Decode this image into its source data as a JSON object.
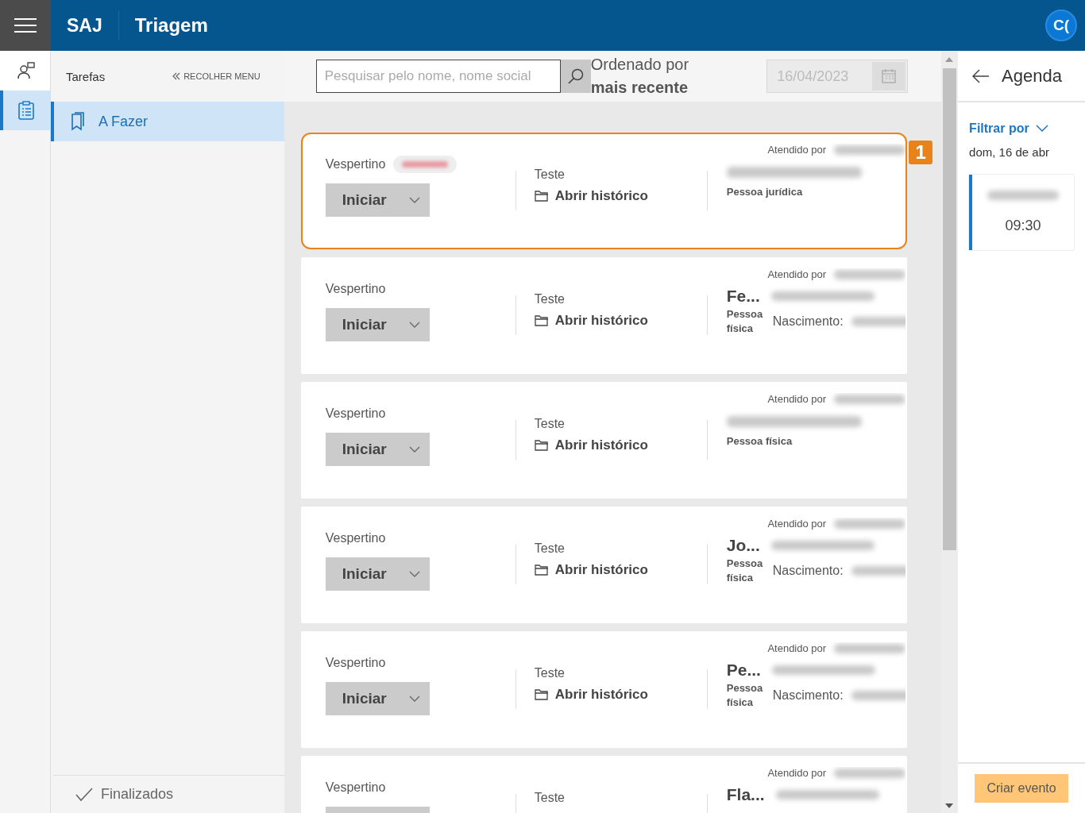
{
  "header": {
    "brand": "SAJ",
    "title": "Triagem",
    "avatar": "C("
  },
  "rail": [
    {
      "kind": "person",
      "selected": false
    },
    {
      "kind": "tasks",
      "selected": true
    }
  ],
  "sidebar": {
    "title": "Tarefas",
    "collapse": "RECOLHER MENU",
    "items": [
      {
        "label": "A Fazer",
        "selected": true
      }
    ],
    "footer": "Finalizados"
  },
  "toolbar": {
    "search_placeholder": "Pesquisar pelo nome, nome social",
    "sort_label": "Ordenado por",
    "sort_value": "mais recente",
    "date": "16/04/2023"
  },
  "cards": [
    {
      "kind": "company",
      "highlighted": true,
      "badge": "1",
      "shift": "Vespertino",
      "tag": true,
      "button": "Iniciar",
      "service": "Teste",
      "history": "Abrir histórico",
      "attended": "Atendido por",
      "person_type": "Pessoa jurídica"
    },
    {
      "kind": "named",
      "highlighted": false,
      "shift": "Vespertino",
      "tag": false,
      "button": "Iniciar",
      "service": "Teste",
      "history": "Abrir histórico",
      "attended": "Atendido por",
      "name": "Fe...",
      "person_type": "Pessoa física",
      "birth": "Nascimento:"
    },
    {
      "kind": "company",
      "highlighted": false,
      "shift": "Vespertino",
      "tag": false,
      "button": "Iniciar",
      "service": "Teste",
      "history": "Abrir histórico",
      "attended": "Atendido por",
      "person_type": "Pessoa física"
    },
    {
      "kind": "named",
      "highlighted": false,
      "shift": "Vespertino",
      "tag": false,
      "button": "Iniciar",
      "service": "Teste",
      "history": "Abrir histórico",
      "attended": "Atendido por",
      "name": "Jo...",
      "person_type": "Pessoa física",
      "birth": "Nascimento:"
    },
    {
      "kind": "named",
      "highlighted": false,
      "shift": "Vespertino",
      "tag": false,
      "button": "Iniciar",
      "service": "Teste",
      "history": "Abrir histórico",
      "attended": "Atendido por",
      "name": "Pe...",
      "person_type": "Pessoa física",
      "birth": "Nascimento:"
    },
    {
      "kind": "named",
      "highlighted": false,
      "shift": "Vespertino",
      "tag": false,
      "service": "Teste",
      "attended": "Atendido por",
      "name": "Fla..."
    }
  ],
  "agenda": {
    "title": "Agenda",
    "filter": "Filtrar por",
    "date": "dom, 16 de abr",
    "events": [
      {
        "time": "09:30"
      }
    ],
    "create_button": "Criar evento"
  }
}
